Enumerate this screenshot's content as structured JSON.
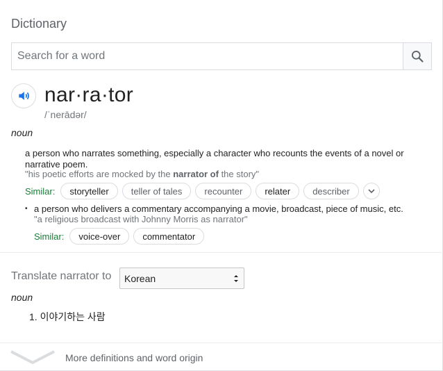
{
  "card": {
    "title": "Dictionary",
    "search": {
      "placeholder": "Search for a word",
      "button_icon": "search-icon"
    },
    "entry": {
      "speaker_icon": "speaker-icon",
      "headword": "nar·ra·tor",
      "pronunciation": "/ˈnerādər/",
      "part_of_speech": "noun",
      "senses": [
        {
          "definition": "a person who narrates something, especially a character who recounts the events of a novel or narrative poem.",
          "example_prefix": "\"his poetic efforts are mocked by the ",
          "example_bold": "narrator of",
          "example_suffix": " the story\"",
          "similar_label": "Similar:",
          "similar": [
            "storyteller",
            "teller of tales",
            "recounter",
            "relater",
            "describer"
          ],
          "expand_icon": "chevron-down-icon"
        },
        {
          "bullet": "•",
          "definition": "a person who delivers a commentary accompanying a movie, broadcast, piece of music, etc.",
          "example": "\"a religious broadcast with Johnny Morris as narrator\"",
          "similar_label": "Similar:",
          "similar": [
            "voice-over",
            "commentator"
          ]
        }
      ]
    },
    "translate": {
      "label": "Translate narrator to",
      "language": "Korean",
      "part_of_speech": "noun",
      "items": [
        "1. 이야기하는 사람"
      ]
    },
    "more": {
      "label": "More definitions and word origin",
      "icon": "chevron-down-icon"
    }
  }
}
